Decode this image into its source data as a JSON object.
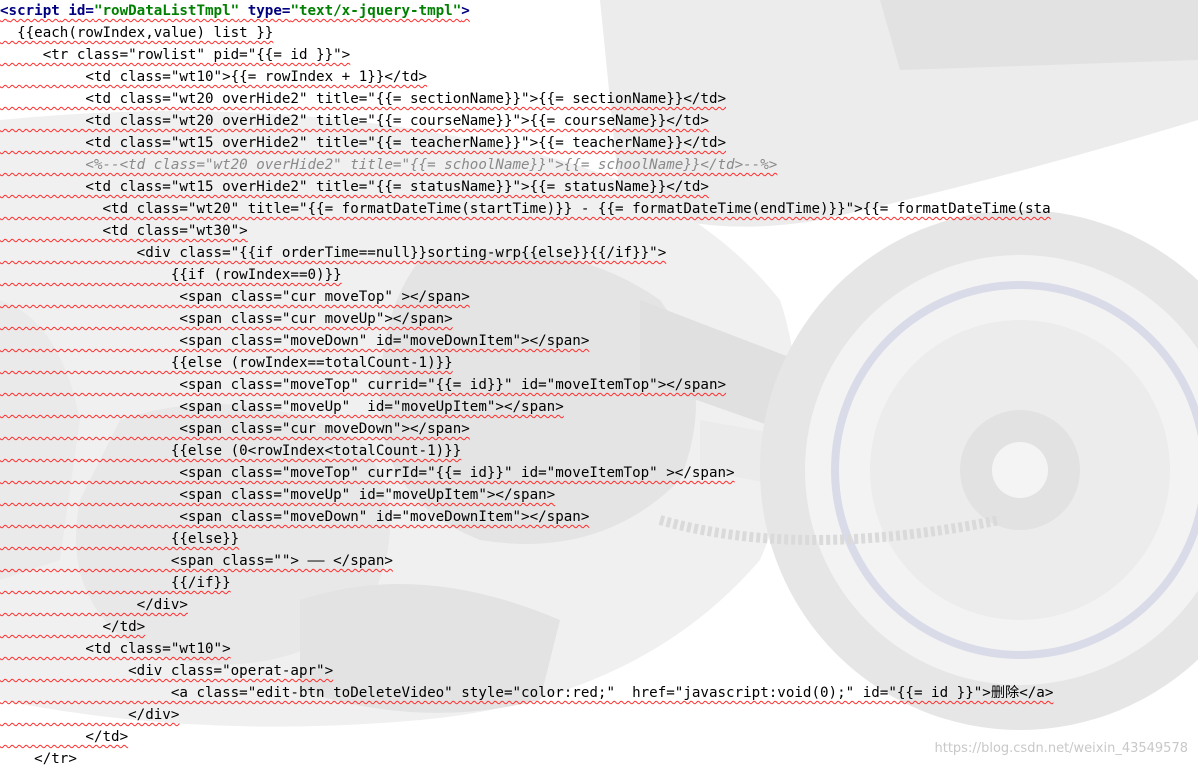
{
  "script_open": {
    "lt": "<",
    "tag": "script",
    "attr1": " id=",
    "val1": "\"rowDataListTmpl\"",
    "attr2": " type=",
    "val2": "\"text/x-jquery-tmpl\"",
    "gt": ">"
  },
  "code_lines": [
    "  {{each(rowIndex,value) list }}",
    "     <tr class=\"rowlist\" pid=\"{{= id }}\">",
    "          <td class=\"wt10\">{{= rowIndex + 1}}</td>",
    "          <td class=\"wt20 overHide2\" title=\"{{= sectionName}}\">{{= sectionName}}</td>",
    "          <td class=\"wt20 overHide2\" title=\"{{= courseName}}\">{{= courseName}}</td>",
    "          <td class=\"wt15 overHide2\" title=\"{{= teacherName}}\">{{= teacherName}}</td>",
    "          <%--<td class=\"wt20 overHide2\" title=\"{{= schoolName}}\">{{= schoolName}}</td>--%>",
    "          <td class=\"wt15 overHide2\" title=\"{{= statusName}}\">{{= statusName}}</td>",
    "            <td class=\"wt20\" title=\"{{= formatDateTime(startTime)}} - {{= formatDateTime(endTime)}}\">{{= formatDateTime(sta",
    "            <td class=\"wt30\">",
    "                <div class=\"{{if orderTime==null}}sorting-wrp{{else}}{{/if}}\">",
    "                    {{if (rowIndex==0)}}",
    "                     <span class=\"cur moveTop\" ></span>",
    "                     <span class=\"cur moveUp\"></span>",
    "                     <span class=\"moveDown\" id=\"moveDownItem\"></span>",
    "                    {{else (rowIndex==totalCount-1)}}",
    "                     <span class=\"moveTop\" currid=\"{{= id}}\" id=\"moveItemTop\"></span>",
    "                     <span class=\"moveUp\"  id=\"moveUpItem\"></span>",
    "                     <span class=\"cur moveDown\"></span>",
    "                    {{else (0<rowIndex<totalCount-1)}}",
    "                     <span class=\"moveTop\" currId=\"{{= id}}\" id=\"moveItemTop\" ></span>",
    "                     <span class=\"moveUp\" id=\"moveUpItem\"></span>",
    "                     <span class=\"moveDown\" id=\"moveDownItem\"></span>",
    "                    {{else}}",
    "                    <span class=\"\"> —— </span>",
    "                    {{/if}}",
    "                </div>",
    "            </td>",
    "          <td class=\"wt10\">",
    "               <div class=\"operat-apr\">",
    "                    <a class=\"edit-btn toDeleteVideo\" style=\"color:red;\"  href=\"javascript:void(0);\" id=\"{{= id }}\">删除</a>",
    "               </div>",
    "          </td>",
    "    </tr>"
  ],
  "comment_line_index": 6,
  "watermark": "https://blog.csdn.net/weixin_43549578",
  "colors": {
    "tag": "#000080",
    "value": "#008000",
    "comment": "#8a8a8a",
    "squiggle": "#ff2b2b"
  }
}
